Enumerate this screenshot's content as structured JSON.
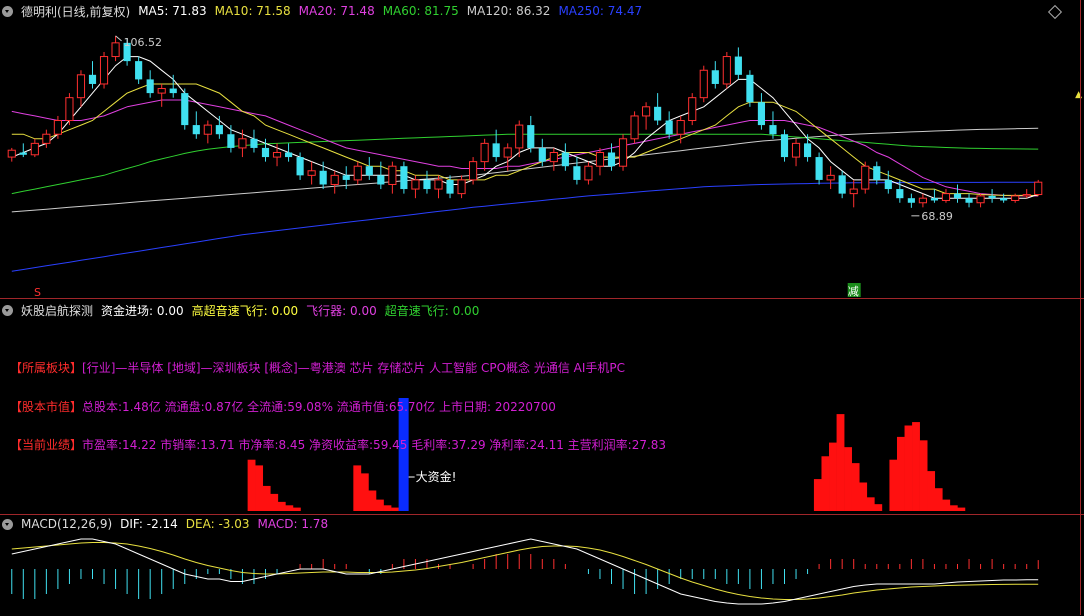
{
  "main": {
    "title": "德明利(日线,前复权)",
    "ma": [
      {
        "label": "MA5: 71.83",
        "color": "#ffffff"
      },
      {
        "label": "MA10: 71.58",
        "color": "#e8e040"
      },
      {
        "label": "MA20: 71.48",
        "color": "#e040e0"
      },
      {
        "label": "MA60: 81.75",
        "color": "#30d030"
      },
      {
        "label": "MA120: 86.32",
        "color": "#cccccc"
      },
      {
        "label": "MA250: 74.47",
        "color": "#2a40ff"
      }
    ],
    "high_label": "106.52",
    "low_label": "68.89",
    "marker_s": "S",
    "marker_jian": "减"
  },
  "indicator": {
    "title": "妖股启航探测",
    "items": [
      {
        "label": "资金进场: 0.00",
        "color": "#ffffff"
      },
      {
        "label": "高超音速飞行: 0.00",
        "color": "#ffff40"
      },
      {
        "label": "飞行器: 0.00",
        "color": "#e040e0"
      },
      {
        "label": "超音速飞行: 0.00",
        "color": "#30d030"
      }
    ],
    "sector_key": "【所属板块】",
    "sector_text": "[行业]—半导体 [地域]—深圳板块 [概念]—粤港澳 芯片 存储芯片 人工智能 CPO概念 光通信 AI手机PC",
    "capital_key": "【股本市值】",
    "capital_text": "总股本:1.48亿 流通盘:0.87亿 全流通:59.08% 流通市值:65.70亿 上市日期: 20220700",
    "perf_key": "【当前业绩】",
    "perf_text": "市盈率:14.22 市销率:13.71 市净率:8.45 净资收益率:59.45 毛利率:37.29 净利率:24.11 主营利润率:27.83",
    "big_fund_1": "大资金!",
    "big_fund_2": "大资金!"
  },
  "macd": {
    "title": "MACD(12,26,9)",
    "dif": "DIF: -2.14",
    "dea": "DEA: -3.03",
    "macd": "MACD: 1.78"
  },
  "chart_data": {
    "type": "candlestick",
    "candles": [
      [
        80,
        82,
        79,
        81.5
      ],
      [
        81,
        83,
        80,
        80.5
      ],
      [
        80.5,
        84,
        80,
        83
      ],
      [
        83,
        86,
        82,
        85
      ],
      [
        85,
        89,
        84,
        88
      ],
      [
        88,
        94,
        87,
        93
      ],
      [
        93,
        99,
        91,
        98
      ],
      [
        98,
        101,
        95,
        96
      ],
      [
        96,
        103,
        95,
        102
      ],
      [
        102,
        106.52,
        101,
        105
      ],
      [
        105,
        106,
        100,
        101
      ],
      [
        101,
        102,
        96,
        97
      ],
      [
        97,
        99,
        93,
        94
      ],
      [
        94,
        96,
        91,
        95
      ],
      [
        95,
        98,
        93,
        94
      ],
      [
        94,
        95,
        86,
        87
      ],
      [
        87,
        90,
        84,
        85
      ],
      [
        85,
        88,
        83,
        87
      ],
      [
        87,
        89,
        84,
        85
      ],
      [
        85,
        87,
        81,
        82
      ],
      [
        82,
        86,
        80,
        84
      ],
      [
        84,
        86,
        81,
        82
      ],
      [
        82,
        84,
        79,
        80
      ],
      [
        80,
        83,
        78,
        81
      ],
      [
        81,
        83,
        79,
        80
      ],
      [
        80,
        81,
        75,
        76
      ],
      [
        76,
        79,
        74,
        77
      ],
      [
        77,
        79,
        73,
        74
      ],
      [
        74,
        77,
        72,
        76
      ],
      [
        76,
        78,
        73,
        75
      ],
      [
        75,
        79,
        74,
        78
      ],
      [
        78,
        80,
        75,
        76
      ],
      [
        76,
        79,
        73,
        74
      ],
      [
        74,
        79,
        72,
        78
      ],
      [
        78,
        79,
        72,
        73
      ],
      [
        73,
        76,
        71,
        75
      ],
      [
        75,
        77,
        72,
        73
      ],
      [
        73,
        76,
        71,
        75
      ],
      [
        75,
        76,
        71,
        72
      ],
      [
        72,
        76,
        71,
        75
      ],
      [
        75,
        80,
        74,
        79
      ],
      [
        79,
        84,
        77,
        83
      ],
      [
        83,
        86,
        79,
        80
      ],
      [
        80,
        83,
        77,
        82
      ],
      [
        82,
        88,
        80,
        87
      ],
      [
        87,
        89,
        81,
        82
      ],
      [
        82,
        84,
        78,
        79
      ],
      [
        79,
        82,
        77,
        81
      ],
      [
        81,
        83,
        77,
        78
      ],
      [
        78,
        80,
        74,
        75
      ],
      [
        75,
        79,
        74,
        78
      ],
      [
        78,
        82,
        76,
        81
      ],
      [
        81,
        83,
        77,
        78
      ],
      [
        78,
        85,
        77,
        84
      ],
      [
        84,
        90,
        83,
        89
      ],
      [
        89,
        92,
        86,
        91
      ],
      [
        91,
        94,
        87,
        88
      ],
      [
        88,
        90,
        84,
        85
      ],
      [
        85,
        89,
        83,
        88
      ],
      [
        88,
        94,
        87,
        93
      ],
      [
        93,
        100,
        92,
        99
      ],
      [
        99,
        101,
        95,
        96
      ],
      [
        96,
        103,
        95,
        102
      ],
      [
        102,
        104,
        97,
        98
      ],
      [
        98,
        99,
        91,
        92
      ],
      [
        92,
        94,
        86,
        87
      ],
      [
        87,
        90,
        84,
        85
      ],
      [
        85,
        86,
        79,
        80
      ],
      [
        80,
        84,
        78,
        83
      ],
      [
        83,
        85,
        79,
        80
      ],
      [
        80,
        81,
        74,
        75
      ],
      [
        75,
        78,
        73,
        76
      ],
      [
        76,
        77,
        71,
        72
      ],
      [
        72,
        75,
        69,
        73
      ],
      [
        73,
        79,
        72,
        78
      ],
      [
        78,
        79,
        74,
        75
      ],
      [
        75,
        77,
        72,
        73
      ],
      [
        73,
        75,
        70,
        71
      ],
      [
        71,
        72,
        68.89,
        70
      ],
      [
        70,
        72,
        69,
        71
      ],
      [
        71,
        73,
        70,
        70.5
      ],
      [
        70.5,
        73,
        70,
        72
      ],
      [
        72,
        74,
        70,
        71
      ],
      [
        71,
        72,
        69,
        70
      ],
      [
        70,
        72,
        69,
        71.5
      ],
      [
        71.5,
        73,
        70,
        71
      ],
      [
        71,
        72,
        70,
        70.5
      ],
      [
        70.5,
        72,
        70,
        71.5
      ],
      [
        71.5,
        73,
        71,
        71.8
      ],
      [
        71.8,
        75,
        71.5,
        74.5
      ]
    ],
    "ma5": [
      80,
      81,
      82,
      83,
      85,
      88,
      91,
      94,
      97,
      100,
      102,
      102,
      101,
      99,
      97,
      94,
      92,
      90,
      88,
      86,
      85,
      84,
      83,
      82,
      81,
      80,
      79,
      78,
      77,
      76,
      76,
      76,
      76,
      76,
      76,
      75,
      75,
      75,
      74,
      74,
      75,
      76,
      78,
      79,
      81,
      82,
      82,
      82,
      81,
      80,
      79,
      78,
      78,
      79,
      81,
      84,
      86,
      88,
      89,
      90,
      91,
      93,
      95,
      97,
      97,
      95,
      93,
      90,
      87,
      84,
      82,
      79,
      77,
      75,
      75,
      75,
      75,
      74,
      73,
      72,
      71,
      71,
      71,
      71,
      71,
      71,
      71,
      71,
      71,
      71.83
    ],
    "ma10": [
      85,
      85,
      84,
      84,
      85,
      86,
      87,
      88,
      90,
      92,
      94,
      95,
      96,
      96,
      96,
      96,
      96,
      95,
      94,
      92,
      90,
      89,
      87,
      86,
      85,
      84,
      83,
      82,
      81,
      80,
      79,
      78,
      78,
      77,
      77,
      76,
      76,
      76,
      75,
      75,
      75,
      75,
      76,
      76,
      77,
      78,
      79,
      80,
      81,
      81,
      81,
      80,
      80,
      80,
      80,
      81,
      82,
      83,
      84,
      85,
      86,
      87,
      89,
      91,
      92,
      92,
      92,
      91,
      90,
      88,
      86,
      84,
      82,
      80,
      78,
      77,
      76,
      75,
      74,
      73,
      73,
      72,
      72,
      72,
      71.8,
      71.7,
      71.6,
      71.6,
      71.6,
      71.58
    ],
    "ma20": [
      90,
      89.5,
      89,
      88.5,
      88,
      88,
      88,
      88.5,
      89,
      90,
      91,
      91.5,
      92,
      92.5,
      92.5,
      92.5,
      92,
      91.5,
      91,
      90.5,
      90,
      89.5,
      89,
      88,
      87,
      86,
      85,
      84,
      83,
      82,
      81.5,
      81,
      80.5,
      80,
      79.5,
      79,
      78.5,
      78,
      78,
      77.5,
      77.5,
      77.5,
      77.5,
      78,
      78,
      78.5,
      79,
      79.5,
      80,
      80.5,
      81,
      81.5,
      82,
      82.5,
      83,
      83.5,
      84,
      84.5,
      85,
      85.5,
      86,
      86.5,
      87,
      87.5,
      88,
      88,
      88,
      88,
      87.5,
      87,
      86.5,
      85.5,
      84.5,
      83.5,
      82.5,
      81,
      80,
      78.5,
      77,
      75.5,
      74.5,
      73.5,
      73,
      72.5,
      72,
      71.8,
      71.6,
      71.5,
      71.5,
      71.48
    ],
    "ma60": [
      72,
      72.5,
      73,
      73.5,
      74,
      74.5,
      75,
      75.5,
      76,
      76.8,
      77.5,
      78.2,
      79,
      79.6,
      80.2,
      80.8,
      81.3,
      81.7,
      82,
      82.3,
      82.5,
      82.7,
      82.9,
      83,
      83.1,
      83.2,
      83.3,
      83.4,
      83.5,
      83.6,
      83.7,
      83.8,
      83.9,
      84,
      84.1,
      84.2,
      84.3,
      84.4,
      84.5,
      84.6,
      84.7,
      84.8,
      84.9,
      85,
      85,
      85,
      85,
      85,
      85,
      85,
      85,
      85,
      85,
      85,
      85,
      85,
      85,
      85,
      85,
      85,
      85,
      85,
      85,
      85,
      85,
      85,
      84.8,
      84.6,
      84.4,
      84.2,
      84,
      83.8,
      83.6,
      83.4,
      83.2,
      83,
      82.8,
      82.6,
      82.4,
      82.3,
      82.2,
      82.1,
      82,
      81.95,
      81.9,
      81.85,
      81.8,
      81.78,
      81.76,
      81.75
    ],
    "ma120": [
      68,
      68.2,
      68.4,
      68.6,
      68.8,
      69,
      69.2,
      69.4,
      69.6,
      69.8,
      70,
      70.2,
      70.4,
      70.6,
      70.8,
      71,
      71.2,
      71.4,
      71.6,
      71.8,
      72,
      72.2,
      72.4,
      72.6,
      72.8,
      73,
      73.2,
      73.4,
      73.6,
      73.8,
      74,
      74.2,
      74.4,
      74.6,
      74.8,
      75,
      75.2,
      75.4,
      75.6,
      75.8,
      76,
      76.3,
      76.6,
      76.9,
      77.2,
      77.5,
      77.8,
      78.1,
      78.4,
      78.7,
      79,
      79.3,
      79.6,
      79.9,
      80.2,
      80.5,
      80.8,
      81.1,
      81.4,
      81.7,
      82,
      82.3,
      82.6,
      82.9,
      83.2,
      83.5,
      83.7,
      83.9,
      84.1,
      84.3,
      84.5,
      84.7,
      84.9,
      85,
      85.1,
      85.2,
      85.3,
      85.4,
      85.5,
      85.6,
      85.7,
      85.8,
      85.9,
      86,
      86.05,
      86.1,
      86.15,
      86.2,
      86.26,
      86.32
    ],
    "ma250": [
      55,
      55.4,
      55.8,
      56.2,
      56.6,
      57,
      57.4,
      57.8,
      58.2,
      58.6,
      59,
      59.4,
      59.8,
      60.2,
      60.6,
      61,
      61.4,
      61.8,
      62.2,
      62.6,
      63,
      63.3,
      63.6,
      63.9,
      64.2,
      64.5,
      64.8,
      65.1,
      65.4,
      65.7,
      66,
      66.3,
      66.6,
      66.9,
      67.2,
      67.5,
      67.8,
      68.1,
      68.4,
      68.7,
      69,
      69.25,
      69.5,
      69.75,
      70,
      70.25,
      70.5,
      70.75,
      71,
      71.25,
      71.5,
      71.7,
      71.9,
      72.1,
      72.3,
      72.5,
      72.7,
      72.9,
      73.1,
      73.3,
      73.5,
      73.6,
      73.7,
      73.8,
      73.9,
      74,
      74.05,
      74.1,
      74.15,
      74.2,
      74.25,
      74.3,
      74.33,
      74.36,
      74.38,
      74.4,
      74.41,
      74.42,
      74.43,
      74.44,
      74.45,
      74.45,
      74.46,
      74.46,
      74.46,
      74.47,
      74.47,
      74.47,
      74.47,
      74.47
    ],
    "ylim": [
      52,
      110
    ],
    "indicator_bars": [
      0,
      0,
      0,
      0,
      0,
      0,
      0,
      0,
      0,
      0,
      0,
      0,
      0,
      0,
      0,
      0,
      0,
      0,
      0,
      0,
      0,
      0,
      0,
      0,
      0,
      0,
      0,
      0,
      0,
      0,
      0,
      0,
      45,
      40,
      22,
      15,
      8,
      5,
      3,
      0,
      0,
      0,
      0,
      0,
      0,
      0,
      40,
      33,
      18,
      10,
      5,
      3,
      0,
      0,
      0,
      0,
      0,
      0,
      0,
      0,
      0,
      0,
      0,
      0,
      0,
      0,
      0,
      0,
      0,
      0,
      0,
      0,
      0,
      0,
      0,
      0,
      0,
      0,
      0,
      0,
      0,
      0,
      0,
      0,
      0,
      0,
      0,
      0,
      0,
      0,
      0,
      0,
      0,
      0,
      0,
      0,
      0,
      0,
      0,
      0,
      0,
      0,
      0,
      0,
      0,
      0,
      0,
      28,
      48,
      60,
      85,
      56,
      42,
      25,
      12,
      6,
      0,
      45,
      65,
      75,
      78,
      62,
      35,
      20,
      10,
      5,
      3,
      0,
      0,
      0,
      0,
      0,
      0,
      0,
      0,
      0,
      0,
      0
    ],
    "big_fund_bars": [
      52,
      161
    ],
    "indicator_ylim": [
      0,
      100
    ],
    "macd_hist": [
      -5,
      -6,
      -6,
      -5,
      -4,
      -3,
      -2,
      -2,
      -3,
      -4,
      -5,
      -6,
      -6,
      -5,
      -4,
      -3,
      -2,
      -1,
      -1,
      -2,
      -3,
      -3,
      -2,
      -1,
      0,
      1,
      1,
      2,
      1,
      1,
      0,
      -1,
      -1,
      1,
      2,
      2,
      2,
      1,
      1,
      0,
      1,
      2,
      3,
      3,
      3,
      3,
      2,
      2,
      1,
      0,
      -1,
      -2,
      -3,
      -4,
      -5,
      -5,
      -4,
      -3,
      -2,
      -2,
      -2,
      -2,
      -3,
      -3,
      -4,
      -4,
      -3,
      -3,
      -2,
      -1,
      1,
      2,
      2,
      2,
      1,
      1,
      1,
      1,
      2,
      2,
      1,
      1,
      1,
      2,
      1,
      2,
      1,
      1,
      1,
      1.78
    ],
    "macd_dif": [
      3,
      3.5,
      4,
      4.5,
      5,
      5.5,
      6,
      6,
      5.5,
      5,
      4,
      3,
      2,
      1,
      0,
      -1,
      -1.5,
      -2,
      -2,
      -2.5,
      -2.5,
      -2,
      -1.5,
      -1,
      -0.5,
      0,
      0,
      0,
      -0.5,
      -1,
      -1,
      -1,
      -0.5,
      0,
      0.5,
      1,
      1.5,
      2,
      2.5,
      3,
      3.5,
      4,
      4.5,
      5,
      5.5,
      6,
      5.5,
      5,
      4.5,
      4,
      3,
      2,
      1,
      0,
      -1,
      -2,
      -3,
      -4,
      -5,
      -5.5,
      -6,
      -6.5,
      -6.8,
      -7,
      -7,
      -7,
      -6.8,
      -6.5,
      -6,
      -5.5,
      -5,
      -4.5,
      -4,
      -3.5,
      -3.2,
      -3,
      -3,
      -3,
      -3,
      -3,
      -3,
      -2.8,
      -2.6,
      -2.5,
      -2.4,
      -2.3,
      -2.2,
      -2.2,
      -2.15,
      -2.14
    ],
    "macd_dea": [
      4,
      4.2,
      4.4,
      4.6,
      4.8,
      5,
      5.2,
      5.3,
      5.3,
      5.2,
      5,
      4.6,
      4.1,
      3.5,
      2.8,
      2,
      1.3,
      0.7,
      0.2,
      -0.3,
      -0.7,
      -0.9,
      -1,
      -1,
      -0.9,
      -0.8,
      -0.7,
      -0.6,
      -0.6,
      -0.6,
      -0.7,
      -0.7,
      -0.7,
      -0.6,
      -0.4,
      -0.2,
      0.1,
      0.5,
      0.9,
      1.3,
      1.8,
      2.3,
      2.8,
      3.3,
      3.8,
      4.2,
      4.5,
      4.6,
      4.6,
      4.5,
      4.2,
      3.8,
      3.2,
      2.5,
      1.7,
      0.9,
      0,
      -0.9,
      -1.8,
      -2.6,
      -3.3,
      -4,
      -4.6,
      -5.1,
      -5.5,
      -5.8,
      -6,
      -6.1,
      -6.1,
      -6,
      -5.8,
      -5.5,
      -5.2,
      -4.8,
      -4.5,
      -4.2,
      -4,
      -3.8,
      -3.6,
      -3.5,
      -3.4,
      -3.3,
      -3.25,
      -3.2,
      -3.15,
      -3.1,
      -3.08,
      -3.06,
      -3.04,
      -3.03
    ],
    "macd_ylim": [
      -9,
      8
    ]
  }
}
